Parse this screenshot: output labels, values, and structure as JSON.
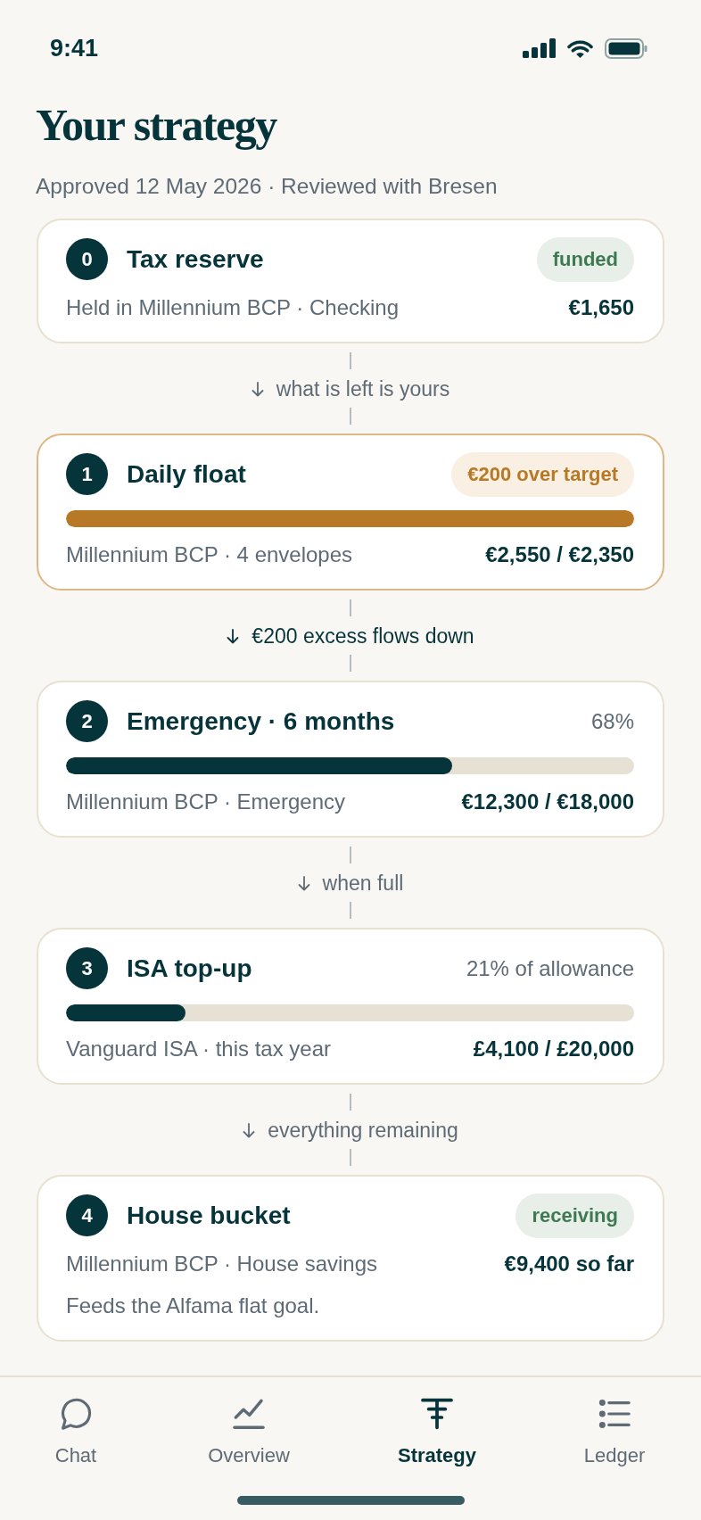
{
  "status_bar": {
    "time": "9:41"
  },
  "header": {
    "title": "Your strategy",
    "subtitle": "Approved 12 May 2026 · Reviewed with Bresen"
  },
  "buckets": [
    {
      "number": "0",
      "title": "Tax reserve",
      "highlighted": false,
      "badge": {
        "label": "funded",
        "kind": "positive"
      },
      "account": "Held in Millennium BCP · Checking",
      "amount": "€1,650",
      "flow": {
        "text": "what is left is yours",
        "emphasis": false
      }
    },
    {
      "number": "1",
      "title": "Daily float",
      "highlighted": true,
      "badge": {
        "label": "€200 over target",
        "kind": "warning"
      },
      "progress": {
        "level": 1,
        "kind": "warning"
      },
      "account": "Millennium BCP · 4 envelopes",
      "amount": "€2,550 / €2,350",
      "flow": {
        "text": "€200 excess flows down",
        "emphasis": true
      }
    },
    {
      "number": "2",
      "title": "Emergency · 6 months",
      "highlighted": false,
      "stat": "68%",
      "progress": {
        "level": 0.68,
        "kind": "normal"
      },
      "account": "Millennium BCP · Emergency",
      "amount": "€12,300 / €18,000",
      "flow": {
        "text": "when full",
        "emphasis": false
      }
    },
    {
      "number": "3",
      "title": "ISA top-up",
      "highlighted": false,
      "stat": "21% of allowance",
      "progress": {
        "level": 0.21,
        "kind": "normal"
      },
      "account": "Vanguard ISA · this tax year",
      "amount": "£4,100 / £20,000",
      "flow": {
        "text": "everything remaining",
        "emphasis": false
      }
    },
    {
      "number": "4",
      "title": "House bucket",
      "highlighted": false,
      "badge": {
        "label": "receiving",
        "kind": "positive"
      },
      "account": "Millennium BCP · House savings",
      "amount": "€9,400 so far",
      "note": "Feeds the Alfama flat goal."
    }
  ],
  "tab_bar": {
    "tabs": [
      {
        "label": "Chat",
        "selected": false
      },
      {
        "label": "Overview",
        "selected": false
      },
      {
        "label": "Strategy",
        "selected": true
      },
      {
        "label": "Ledger",
        "selected": false
      }
    ]
  }
}
